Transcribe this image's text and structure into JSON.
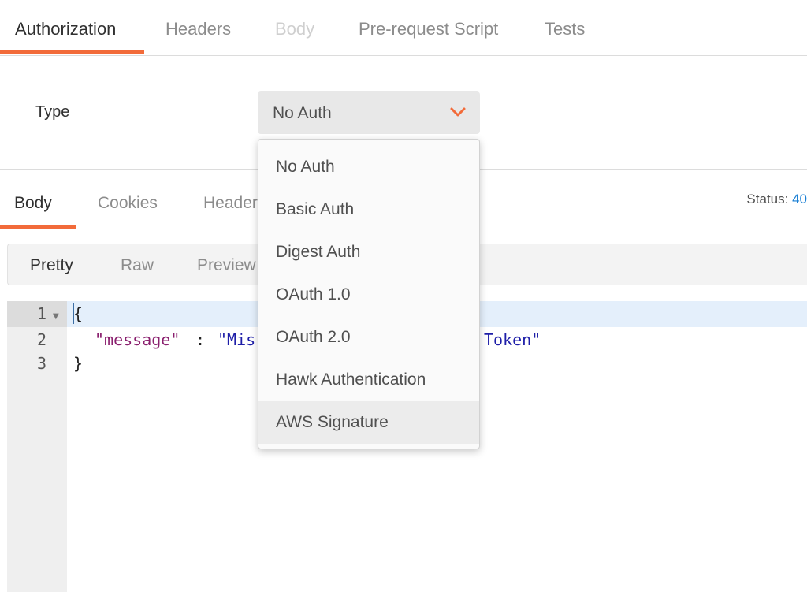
{
  "request_tabs": [
    "Authorization",
    "Headers",
    "Body",
    "Pre-request Script",
    "Tests"
  ],
  "auth": {
    "type_label": "Type",
    "selected": "No Auth",
    "options": [
      "No Auth",
      "Basic Auth",
      "Digest Auth",
      "OAuth 1.0",
      "OAuth 2.0",
      "Hawk Authentication",
      "AWS Signature"
    ],
    "highlighted_option": "AWS Signature"
  },
  "response_tabs": [
    "Body",
    "Cookies",
    "Header"
  ],
  "status": {
    "label": "Status:",
    "value": "40"
  },
  "view_modes": [
    "Pretty",
    "Raw",
    "Preview"
  ],
  "editor": {
    "line_numbers": [
      "1",
      "2",
      "3"
    ],
    "lines": {
      "open_brace": "{",
      "key": "\"message\"",
      "colon": ": ",
      "value_start": "\"Mis",
      "value_end": "Token\"",
      "close_brace": "}"
    }
  },
  "colors": {
    "accent": "#f26b3a",
    "status_value": "#1a7fd4",
    "json_key": "#8a1f6e",
    "json_string": "#1e1ea8"
  }
}
